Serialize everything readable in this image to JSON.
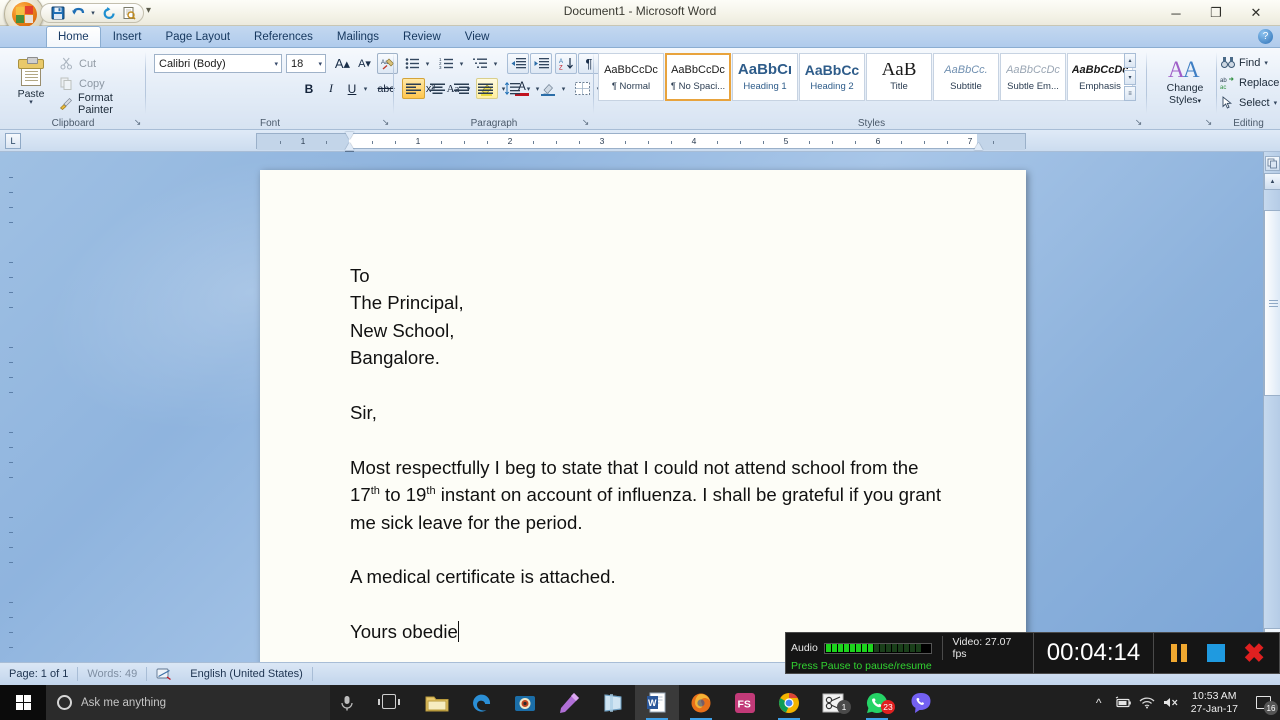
{
  "window": {
    "title": "Document1 - Microsoft Word",
    "minimize": "─",
    "restore": "❐",
    "close": "✕",
    "qat_more": "▾",
    "help": "?"
  },
  "quick_access": [
    {
      "name": "save",
      "glyph": "💾"
    },
    {
      "name": "undo",
      "glyph": "↶"
    },
    {
      "name": "undo-dropdown",
      "glyph": "▾"
    },
    {
      "name": "redo",
      "glyph": "↻"
    },
    {
      "name": "print-preview",
      "glyph": "🔍"
    }
  ],
  "tabs": [
    {
      "label": "Home",
      "active": true
    },
    {
      "label": "Insert",
      "active": false
    },
    {
      "label": "Page Layout",
      "active": false
    },
    {
      "label": "References",
      "active": false
    },
    {
      "label": "Mailings",
      "active": false
    },
    {
      "label": "Review",
      "active": false
    },
    {
      "label": "View",
      "active": false
    }
  ],
  "ribbon": {
    "clipboard": {
      "caption": "Clipboard",
      "paste_label": "Paste",
      "paste_caret": "▾",
      "items": [
        {
          "label": "Cut",
          "icon": "scissors-icon",
          "glyph": "✂",
          "disabled": true
        },
        {
          "label": "Copy",
          "icon": "copy-icon",
          "glyph": "⧉",
          "disabled": true
        },
        {
          "label": "Format Painter",
          "icon": "paintbrush-icon",
          "glyph": "🖌",
          "disabled": false
        }
      ]
    },
    "font": {
      "caption": "Font",
      "font_name": "Calibri (Body)",
      "font_size": "18",
      "caret": "▾",
      "row1": [
        {
          "name": "grow-font-button",
          "label": "A▴"
        },
        {
          "name": "shrink-font-button",
          "label": "A▾"
        },
        {
          "name": "clear-formatting-button",
          "label": "✐"
        }
      ],
      "row2": [
        {
          "name": "bold-button",
          "label": "B"
        },
        {
          "name": "italic-button",
          "label": "I"
        },
        {
          "name": "underline-button",
          "label": "U"
        },
        {
          "name": "underline-dropdown",
          "label": "▾"
        },
        {
          "name": "strikethrough-button",
          "label": "abc"
        },
        {
          "name": "subscript-button",
          "label": "x₂"
        },
        {
          "name": "superscript-button",
          "label": "x²"
        },
        {
          "name": "change-case-button",
          "label": "Aa"
        },
        {
          "name": "change-case-dropdown",
          "label": "▾"
        },
        {
          "name": "text-highlight-button",
          "label": "ab"
        },
        {
          "name": "text-highlight-dropdown",
          "label": "▾"
        },
        {
          "name": "font-color-button",
          "label": "A"
        },
        {
          "name": "font-color-dropdown",
          "label": "▾"
        }
      ]
    },
    "paragraph": {
      "caption": "Paragraph",
      "row1": [
        {
          "name": "bullets-button",
          "label": "☰"
        },
        {
          "name": "bullets-dropdown",
          "label": "▾"
        },
        {
          "name": "numbering-button",
          "label": "☰"
        },
        {
          "name": "numbering-dropdown",
          "label": "▾"
        },
        {
          "name": "multilevel-list-button",
          "label": "☰"
        },
        {
          "name": "multilevel-list-dropdown",
          "label": "▾"
        },
        {
          "name": "decrease-indent-button",
          "label": "⇤"
        },
        {
          "name": "increase-indent-button",
          "label": "⇥"
        },
        {
          "name": "sort-button",
          "label": "A↓"
        },
        {
          "name": "show-formatting-marks-button",
          "label": "¶"
        }
      ],
      "row2": [
        {
          "name": "align-left-button",
          "label": "≡",
          "selected": true
        },
        {
          "name": "align-center-button",
          "label": "≡",
          "selected": false
        },
        {
          "name": "align-right-button",
          "label": "≡",
          "selected": false
        },
        {
          "name": "justify-button",
          "label": "≡",
          "selected": false
        },
        {
          "name": "line-spacing-button",
          "label": "↕"
        },
        {
          "name": "line-spacing-dropdown",
          "label": "▾"
        },
        {
          "name": "shading-button",
          "label": "▣"
        },
        {
          "name": "shading-dropdown",
          "label": "▾"
        },
        {
          "name": "borders-button",
          "label": "▦"
        },
        {
          "name": "borders-dropdown",
          "label": "▾"
        }
      ]
    },
    "styles": {
      "caption": "Styles",
      "gallery": [
        {
          "preview": "AaBbCcDc",
          "label": "¶ Normal",
          "selected": false,
          "style": "normal"
        },
        {
          "preview": "AaBbCcDc",
          "label": "¶ No Spaci...",
          "selected": true,
          "style": "nospacing"
        },
        {
          "preview": "AaBbCı",
          "label": "Heading 1",
          "selected": false,
          "style": "h1"
        },
        {
          "preview": "AaBbCc",
          "label": "Heading 2",
          "selected": false,
          "style": "h2"
        },
        {
          "preview": "AaB",
          "label": "Title",
          "selected": false,
          "style": "title"
        },
        {
          "preview": "AaBbCc.",
          "label": "Subtitle",
          "selected": false,
          "style": "subtitle"
        },
        {
          "preview": "AaBbCcDc",
          "label": "Subtle Em...",
          "selected": false,
          "style": "subtle"
        },
        {
          "preview": "AaBbCcDc",
          "label": "Emphasis",
          "selected": false,
          "style": "emphasis"
        }
      ],
      "scroll_up": "▴",
      "scroll_down": "▾",
      "scroll_more": "≡"
    },
    "change_styles": {
      "label_line1": "Change",
      "label_line2": "Styles",
      "caret": "▾"
    },
    "editing": {
      "caption": "Editing",
      "items": [
        {
          "label": "Find",
          "icon": "binoculars-icon",
          "glyph": "🔎",
          "caret": "▾"
        },
        {
          "label": "Replace",
          "icon": "replace-icon",
          "glyph": "ab",
          "caret": ""
        },
        {
          "label": "Select",
          "icon": "pointer-icon",
          "glyph": "↖",
          "caret": "▾"
        }
      ]
    },
    "dialog_launcher": "↘"
  },
  "ruler": {
    "tab_selector": "L",
    "numbers": [
      "1",
      "1",
      "2",
      "3",
      "4",
      "5",
      "6",
      "7"
    ],
    "left_margin_in": 1.0,
    "right_margin_in": 1.0,
    "unit": "inch"
  },
  "document": {
    "lines": [
      {
        "text": "To",
        "type": "p"
      },
      {
        "text": "The Principal,",
        "type": "p"
      },
      {
        "text": "New School,",
        "type": "p"
      },
      {
        "text": "Bangalore.",
        "type": "p"
      },
      {
        "text": "",
        "type": "blank"
      },
      {
        "text": "Sir,",
        "type": "p"
      },
      {
        "text": "",
        "type": "blank"
      },
      {
        "text": "Most respectfully I beg to state that I could not attend school from the 17th to 19th instant on account of influenza. I shall be grateful if you grant me sick leave for the period.",
        "type": "body"
      },
      {
        "text": "",
        "type": "blank"
      },
      {
        "text": "A medical certificate is attached.",
        "type": "p"
      },
      {
        "text": "",
        "type": "blank"
      },
      {
        "text": "Yours obedie",
        "type": "p-caret"
      }
    ],
    "body_parts": {
      "p1": "Most respectfully I beg to state that I could not attend school from the 17",
      "sup1": "th",
      "p2": " to 19",
      "sup2": "th",
      "p3": " instant on account of influenza. I shall be grateful if you grant me sick leave for the period."
    }
  },
  "status_bar": {
    "page": "Page: 1 of 1",
    "words": "Words: 49",
    "proofing_icon": "proofing-errors-icon",
    "language": "English (United States)"
  },
  "recorder": {
    "audio_label": "Audio",
    "audio_level_on": 8,
    "audio_level_total": 16,
    "video_label": "Video: 27.07 fps",
    "hint": "Press Pause to pause/resume",
    "elapsed": "00:04:14",
    "pause_button": "pause-button",
    "stop_button": "stop-button",
    "close_button": "close-button"
  },
  "taskbar": {
    "start": "start-button",
    "search_placeholder": "Ask me anything",
    "apps": [
      {
        "name": "file-explorer",
        "glyph": "📁",
        "color": "#e8c46a",
        "active": false,
        "open": false,
        "badge": ""
      },
      {
        "name": "microsoft-edge",
        "glyph": "e",
        "color": "#2b8fd6",
        "active": false,
        "open": false,
        "badge": ""
      },
      {
        "name": "camera-app",
        "glyph": "◉",
        "color": "#3a9ad9",
        "active": false,
        "open": false,
        "badge": ""
      },
      {
        "name": "pen-tool",
        "glyph": "✒",
        "color": "#b06fd6",
        "active": false,
        "open": false,
        "badge": ""
      },
      {
        "name": "onenote",
        "glyph": "◧",
        "color": "#7fb8d9",
        "active": false,
        "open": false,
        "badge": ""
      },
      {
        "name": "microsoft-word",
        "glyph": "W",
        "color": "#2b579a",
        "active": true,
        "open": true,
        "badge": ""
      },
      {
        "name": "mozilla-firefox",
        "glyph": "◉",
        "color": "#e86a1c",
        "active": false,
        "open": true,
        "badge": ""
      },
      {
        "name": "fs-app",
        "glyph": "FS",
        "color": "#c23a78",
        "active": false,
        "open": false,
        "badge": ""
      },
      {
        "name": "google-chrome",
        "glyph": "◉",
        "color": "#4285f4",
        "active": false,
        "open": true,
        "badge": ""
      },
      {
        "name": "screen-recorder",
        "glyph": "✂",
        "color": "#dddddd",
        "active": false,
        "open": false,
        "badge": "1"
      },
      {
        "name": "whatsapp",
        "glyph": "✆",
        "color": "#25d366",
        "active": false,
        "open": true,
        "badge": "23"
      },
      {
        "name": "viber",
        "glyph": "✆",
        "color": "#7360f2",
        "active": false,
        "open": false,
        "badge": ""
      }
    ],
    "tray": [
      {
        "name": "show-hidden-icons",
        "glyph": "∧"
      },
      {
        "name": "battery-icon",
        "glyph": "🔋"
      },
      {
        "name": "wifi-icon",
        "glyph": "◠"
      },
      {
        "name": "volume-muted-icon",
        "glyph": "🔇"
      }
    ],
    "clock_time": "10:53 AM",
    "clock_date": "27-Jan-17",
    "notification_count": "16"
  }
}
